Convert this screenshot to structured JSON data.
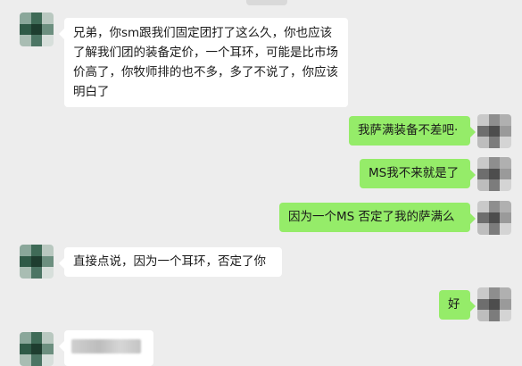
{
  "messages": [
    {
      "side": "left",
      "text": "兄弟，你sm跟我们固定团打了这么久，你也应该了解我们团的装备定价，一个耳环，可能是比市场价高了，你牧师排的也不多，多了不说了，你应该明白了"
    },
    {
      "side": "right",
      "text": "我萨满装备不差吧·"
    },
    {
      "side": "right",
      "text": "MS我不来就是了"
    },
    {
      "side": "right",
      "text": "因为一个MS 否定了我的萨满么"
    },
    {
      "side": "left",
      "text": "直接点说，因为一个耳环，否定了你"
    },
    {
      "side": "right",
      "text": "好"
    }
  ],
  "colors": {
    "background": "#ededed",
    "incoming_bubble": "#ffffff",
    "outgoing_bubble": "#95ec69"
  }
}
